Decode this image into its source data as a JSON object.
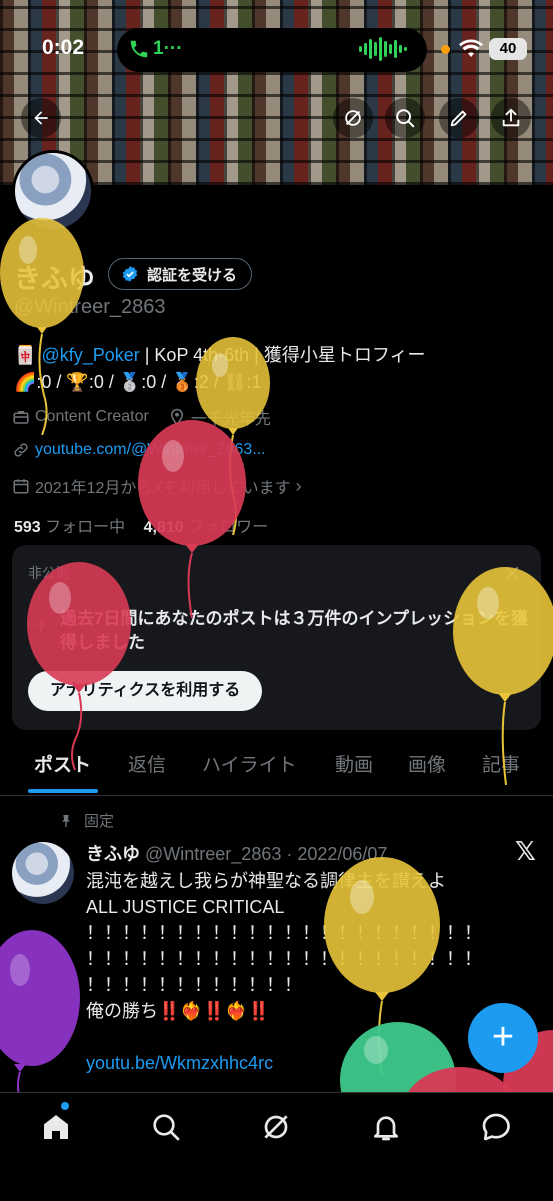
{
  "status_bar": {
    "time": "0:02",
    "call_indicator": "1···",
    "battery": "40"
  },
  "header": {
    "back_icon": "arrow-left-icon",
    "actions": [
      "grok-icon",
      "search-icon",
      "edit-icon",
      "share-icon"
    ]
  },
  "profile": {
    "display_name": "きふゆ",
    "verify_button": "認証を受ける",
    "handle": "@Wintreer_2863",
    "bio_link": "@kfy_Poker",
    "bio_line1_rest": " | KoP 4th-6th | 獲得小星トロフィー",
    "bio_line2": "🌈:0 / 🏆:0 / 🥈:0 / 🥉:2 / ⛓:1",
    "category": "Content Creator",
    "location": "一千光年先",
    "website": "youtube.com/@Wintreer_2863...",
    "joined": "2021年12月からXを利用しています",
    "following_count": "593",
    "following_label": "フォロー中",
    "followers_count": "4,810",
    "followers_label": "フォロワー"
  },
  "analytics_card": {
    "label": "非公開",
    "message": "過去7日間にあなたのポストは３万件のインプレッションを獲得しました",
    "button": "アナリティクスを利用する"
  },
  "tabs": [
    "ポスト",
    "返信",
    "ハイライト",
    "動画",
    "画像",
    "記事"
  ],
  "pinned_post": {
    "pinned_label": "固定",
    "author": "きふゆ",
    "handle_date": "@Wintreer_2863 · 2022/06/07",
    "lines": [
      "混沌を越えし我らが神聖なる調律主を讃えよ",
      "ALL JUSTICE CRITICAL",
      "！！！！！！！！！！！！！！！！！！！！！！",
      "！！！！！！！！！！！！！！！！！！！！！！",
      "！！！！！！！！！！！！",
      "俺の勝ち‼️❤️‍🔥‼️❤️‍🔥‼️",
      ""
    ],
    "link": "youtu.be/Wkmzxhhc4rc"
  },
  "fab": "+",
  "bottom_nav": [
    "home-icon",
    "search-icon",
    "grok-icon",
    "notifications-icon",
    "messages-icon"
  ],
  "colors": {
    "accent": "#1d9bf0",
    "background": "#000000",
    "card": "#16181c",
    "muted": "#71767b",
    "balloon_yellow": "#e8c43a",
    "balloon_red": "#d83a55",
    "balloon_purple": "#8e34c9",
    "balloon_green": "#3ec98c"
  }
}
